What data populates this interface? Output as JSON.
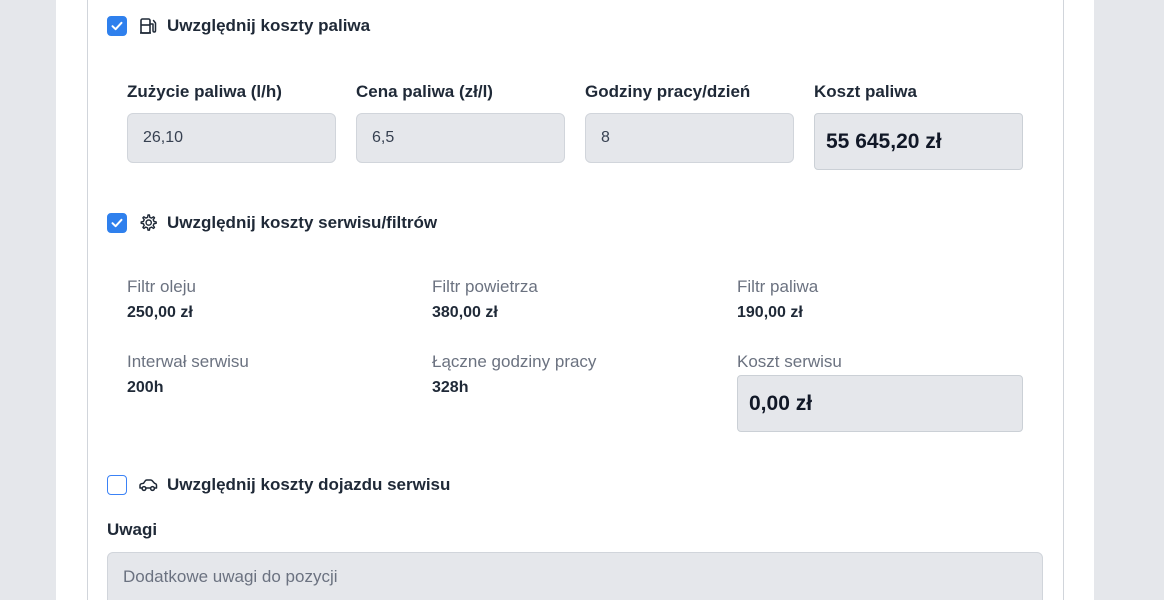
{
  "fuel": {
    "checkbox_label": "Uwzględnij koszty paliwa",
    "checked": true,
    "icon": "fuel-pump-icon",
    "consumption_label": "Zużycie paliwa (l/h)",
    "consumption_value": "26,10",
    "price_label": "Cena paliwa (zł/l)",
    "price_value": "6,5",
    "hours_label": "Godziny pracy/dzień",
    "hours_value": "8",
    "cost_label": "Koszt paliwa",
    "cost_value": "55 645,20 zł"
  },
  "service": {
    "checkbox_label": "Uwzględnij koszty serwisu/filtrów",
    "checked": true,
    "icon": "gear-icon",
    "oil_filter_label": "Filtr oleju",
    "oil_filter_value": "250,00 zł",
    "air_filter_label": "Filtr powietrza",
    "air_filter_value": "380,00 zł",
    "fuel_filter_label": "Filtr paliwa",
    "fuel_filter_value": "190,00 zł",
    "interval_label": "Interwał serwisu",
    "interval_value": "200h",
    "total_hours_label": "Łączne godziny pracy",
    "total_hours_value": "328h",
    "cost_label": "Koszt serwisu",
    "cost_value": "0,00 zł"
  },
  "travel": {
    "checkbox_label": "Uwzględnij koszty dojazdu serwisu",
    "checked": false,
    "icon": "car-icon"
  },
  "notes": {
    "label": "Uwagi",
    "placeholder": "Dodatkowe uwagi do pozycji"
  },
  "colors": {
    "accent": "#2f80ed",
    "field_bg": "#e5e7eb"
  }
}
